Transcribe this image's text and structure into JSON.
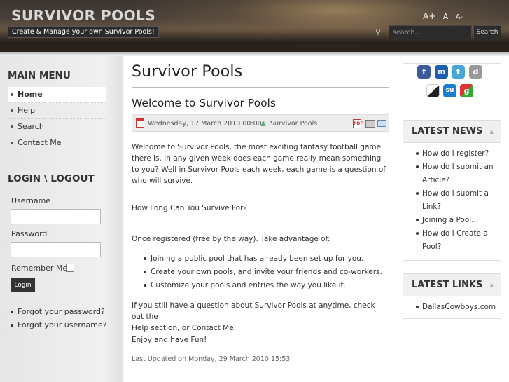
{
  "header": {
    "site_title": "SURVIVOR POOLS",
    "tagline": "Create & Manage your own Survivor Pools!",
    "font_controls": [
      "A+",
      "A",
      "A-"
    ],
    "search_placeholder": "search...",
    "search_button": "Search"
  },
  "left": {
    "main_menu_title": "MAIN MENU",
    "menu_items": [
      "Home",
      "Help",
      "Search",
      "Contact Me"
    ],
    "login_title": "LOGIN \\ LOGOUT",
    "username_label": "Username",
    "password_label": "Password",
    "remember_label": "Remember Me",
    "login_button": "Login",
    "forgot_password": "Forgot your password?",
    "forgot_username": "Forgot your username?"
  },
  "main": {
    "page_title": "Survivor Pools",
    "article_title": "Welcome to Survivor Pools",
    "date": "Wednesday, 17 March 2010 00:00",
    "author": "Survivor Pools",
    "para1": "Welcome to Survivor Pools, the most exciting fantasy football game there is. In any given week does each game really mean something to you? Well in Survivor Pools each week, each game is a question of who will survive.",
    "para2": "How Long Can You Survive For?",
    "para3": "Once registered (free by the way). Take advantage of:",
    "bullets": [
      "Joining a public pool that has already been set up for you.",
      "Create your own pools, and invite your friends and co-workers.",
      "Customize your pools and entries the way you like it."
    ],
    "para4_a": "If you still have a question about Survivor Pools at anytime, check out the",
    "para4_help": "Help",
    "para4_b": " section, or ",
    "para4_contact": "Contact Me",
    "para4_c": ".",
    "para5": "Enjoy and have Fun!",
    "updated": "Last Updated on Monday, 29 March 2010 15:53"
  },
  "right": {
    "latest_news_title": "LATEST NEWS",
    "news_items": [
      "How do I register?",
      "How do I submit an Article?",
      "How do I submit a Link?",
      "Joining a Pool...",
      "How do I Create a Pool?"
    ],
    "latest_links_title": "LATEST LINKS",
    "link_items": [
      "DallasCowboys.com"
    ]
  },
  "social_icons": [
    "facebook-icon",
    "myspace-icon",
    "twitter-icon",
    "digg-icon",
    "delicious-icon",
    "stumbleupon-icon",
    "google-icon"
  ]
}
